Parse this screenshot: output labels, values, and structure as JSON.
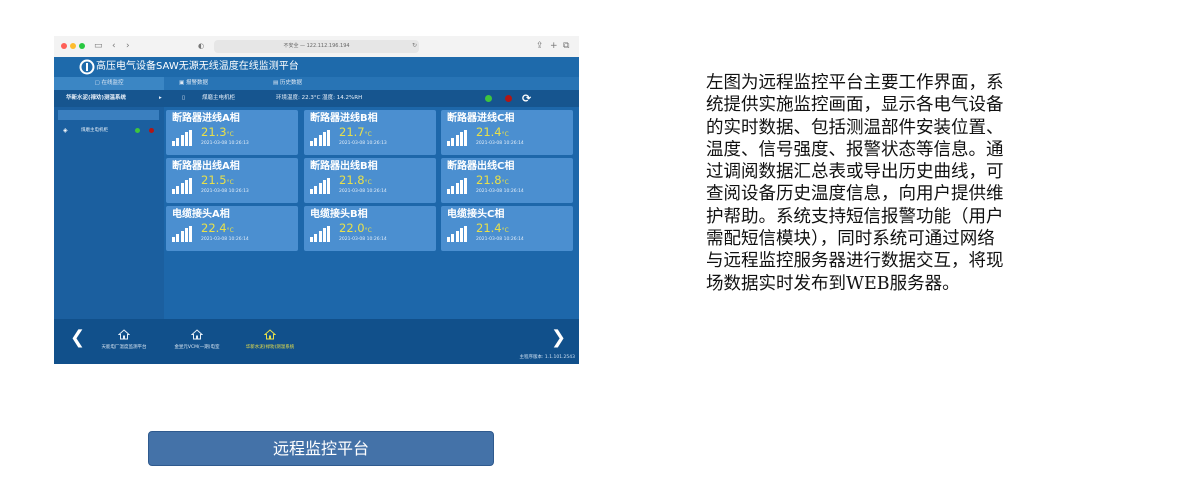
{
  "browser": {
    "url_text": "不安全 — 122.112.196.194"
  },
  "app": {
    "title": "高压电气设备SAW无源无线温度在线监测平台",
    "tabs": [
      {
        "label": "在线监控"
      },
      {
        "label": "报警数据"
      },
      {
        "label": "历史数据"
      }
    ],
    "system_name": "华新水泥(禄劝)测温系统",
    "cabinet": "煤磨主电机柜",
    "environment": "环境温度: 22.3°C  湿度: 14.2%RH",
    "tree_node": "煤磨主电机柜",
    "status_colors": {
      "ok": "#3ec43e",
      "alarm": "#b11616"
    },
    "temp_unit": "°C",
    "cards": [
      {
        "name": "断路器进线A相",
        "temp": "21.3",
        "time": "2021-03-08 10:26:13"
      },
      {
        "name": "断路器进线B相",
        "temp": "21.7",
        "time": "2021-03-08 10:26:13"
      },
      {
        "name": "断路器进线C相",
        "temp": "21.4",
        "time": "2021-03-08 10:26:14"
      },
      {
        "name": "断路器出线A相",
        "temp": "21.5",
        "time": "2021-03-08 10:26:13"
      },
      {
        "name": "断路器出线B相",
        "temp": "21.8",
        "time": "2021-03-08 10:26:14"
      },
      {
        "name": "断路器出线C相",
        "temp": "21.8",
        "time": "2021-03-08 10:26:14"
      },
      {
        "name": "电缆接头A相",
        "temp": "22.4",
        "time": "2021-03-08 10:26:14"
      },
      {
        "name": "电缆接头B相",
        "temp": "22.0",
        "time": "2021-03-08 10:26:14"
      },
      {
        "name": "电缆接头C相",
        "temp": "21.4",
        "time": "2021-03-08 10:26:14"
      }
    ],
    "bottom_nav": [
      {
        "label": "天能电厂温度监测平台"
      },
      {
        "label": "金昱元VCM(一期)电室"
      },
      {
        "label": "华新水泥(禄劝)测温系统"
      }
    ],
    "version": "主程序版本: 1.1.101.2543"
  },
  "description_lines": [
    "左图为远程监控平台主要工作界面，系",
    "统提供实施监控画面，显示各电气设备",
    "的实时数据、包括测温部件安装位置、",
    "温度、信号强度、报警状态等信息。通",
    "过调阅数据汇总表或导出历史曲线，可",
    "查阅设备历史温度信息，向用户提供维",
    "护帮助。系统支持短信报警功能（用户",
    "需配短信模块），同时系统可通过网络",
    "与远程监控服务器进行数据交互，将现",
    "场数据实时发布到WEB服务器。"
  ],
  "caption": "远程监控平台"
}
